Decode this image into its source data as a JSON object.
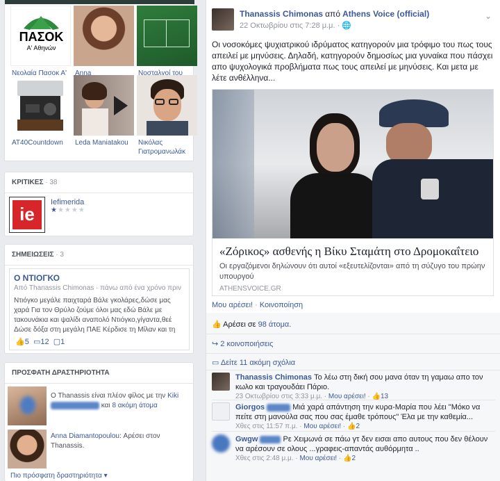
{
  "photos": [
    {
      "label": "Νεολαία Πασοκ Α' Αθήνα...",
      "logo_text": "ΠΑΣΟΚ",
      "logo_sub": "Α' Αθηνών"
    },
    {
      "label": "Anna Diamantopoulou"
    },
    {
      "label": "Νοσταλγοί του \"Subbut..."
    },
    {
      "label": "AT40Countdown"
    },
    {
      "label": "Leda Maniatakou"
    },
    {
      "label": "Νικόλας Γιατρομανωλάκ"
    }
  ],
  "reviews": {
    "title": "ΚΡΙΤΙΚΕΣ",
    "count": "38",
    "item_name": "Iefimerida",
    "item_logo": "ie",
    "rating": 1
  },
  "notes": {
    "title": "ΣΗΜΕΙΩΣΕΙΣ",
    "count": "3",
    "note_title": "Ο ΝΤΙΟΓΚΟ",
    "note_meta": "Από Thanassis Chimonas · πάνω από ένα χρόνο πριν",
    "note_line1": "Ντιόγκο μεγάλε παιχταρά Βάλε γκολάρες,δώσε μας",
    "note_line2": "χαρά Για τον Θρύλο ζούμε όλοι μας εδώ Βάλε με",
    "note_line3": "τακουνάκια και ψαλίδι αναπολό Ντιόγκο,γίγαντα,θεέ",
    "note_line4": "Δώσε δόξα στη μεγάλη ΠΑΕ Κέρδισε τη Μίλαν και τη",
    "likes": "5",
    "comments": "12",
    "shares": "1"
  },
  "activity": {
    "title": "ΠΡΟΣΦΑΤΗ ΔΡΑΣΤΗΡΙΟΤΗΤΑ",
    "item1_pre": "Ο Thanassis είναι πλέον φίλος με την",
    "item1_name": "Kiki",
    "item1_post": "και",
    "item1_more": "8 ακόμη άτομα",
    "item2_name": "Anna Diamantopoulou",
    "item2_text": ": Αρέσει στον Thanassis.",
    "more_link": "Πιο πρόσφατη δραστηριότητα"
  },
  "post": {
    "author": "Thanassis Chimonas",
    "from_word": "από",
    "page": "Athens Voice (official)",
    "time": "22 Οκτωβρίου στις 7:28 μ.μ.",
    "text": "Οι νοσοκόμες ψυχιατρικού ιδρύματος κατηγορούν μια τρόφιμο του πως τους απειλεί με μηνύσεις. Δηλαδή, κατηγορούν δημοσίως μια γυναίκα που πάσχει απο ψυχολογικά προβλήματα πως τους απειλεί με μηνύσεις. Και μετα με λέτε ανθέλληνα...",
    "link_title": "«Ζόρικος» ασθενής η Βίκυ Σταμάτη στο Δρομοκαΐτειο",
    "link_desc": "Οι εργαζόμενοι δηλώνουν ότι αυτοί «εξευτελίζονται» από τη σύζυγο του πρώην υπουργού",
    "link_domain": "ATHENSVOICE.GR",
    "like_action": "Μου αρέσει!",
    "share_action": "Κοινοποίηση",
    "likes_prefix": "Αρέσει σε",
    "likes_count": "98 άτομα.",
    "shares_text": "2 κοινοποιήσεις",
    "more_comments": "Δείτε 11 ακόμη σχόλια"
  },
  "comments": [
    {
      "name": "Thanassis Chimonas",
      "text": "Το λέω στη δική σου μανα όταν τη γαμαω απο τον κωλο και τραγουδάει Πάριο.",
      "time": "23 Οκτωβρίου στις 3:33 μ.μ.",
      "like": "Μου αρέσει!",
      "likes": "13"
    },
    {
      "name": "Giorgos",
      "text": "Μιά χαρά απάντηση την κυρα-Μαρία που λέει \"Μόκο να πείτε στη μανούλα σας που σας έμαθε τρόπους\" Έλα με την καθεμία...",
      "time": "Χθες στις 11:57 π.μ.",
      "like": "Μου αρέσει!",
      "likes": "2"
    },
    {
      "name": "Gwgw",
      "text": "Ρε Χειμωνά σε πάω γτ δεν εισαι απο αυτους που δεν θέλουν να αρέσουν σε ολους ...γραφεις-απαντάς αυθόρμητα ..",
      "time": "Χθες στις 2:48 μ.μ.",
      "like": "Μου αρέσει!",
      "likes": "2"
    }
  ]
}
